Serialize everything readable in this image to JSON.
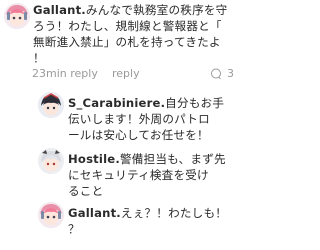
{
  "main_comment": {
    "username": "Gallant.",
    "text": "みんなで執務室の秩序を守ろう！わたし、規制線と警報器と「無断進入禁止」の札を持ってきたよ！",
    "lines": [
      "みんなで執務室の秩序を守",
      "ろう！わたし、規制線と警報器と「",
      "無断進入禁止」の札を持ってきたよ",
      "！"
    ],
    "time": "23min reply",
    "reply_label": "reply",
    "reply_count": "3"
  },
  "replies": [
    {
      "username": "S_Carabiniere.",
      "lines": [
        "自分もお手",
        "伝いします！外周のパトロ",
        "ールは安心してお任せを！"
      ]
    },
    {
      "username": "Hostile.",
      "lines": [
        "警備担当も、まず先",
        "にセキュリティ検査を受け",
        "ること"
      ]
    },
    {
      "username": "Gallant.",
      "lines": [
        "えぇ？！わたしも！",
        "？"
      ]
    }
  ],
  "colors": {
    "text": "#2b2b2b",
    "meta": "#9a9a9a",
    "background": "#ffffff"
  }
}
